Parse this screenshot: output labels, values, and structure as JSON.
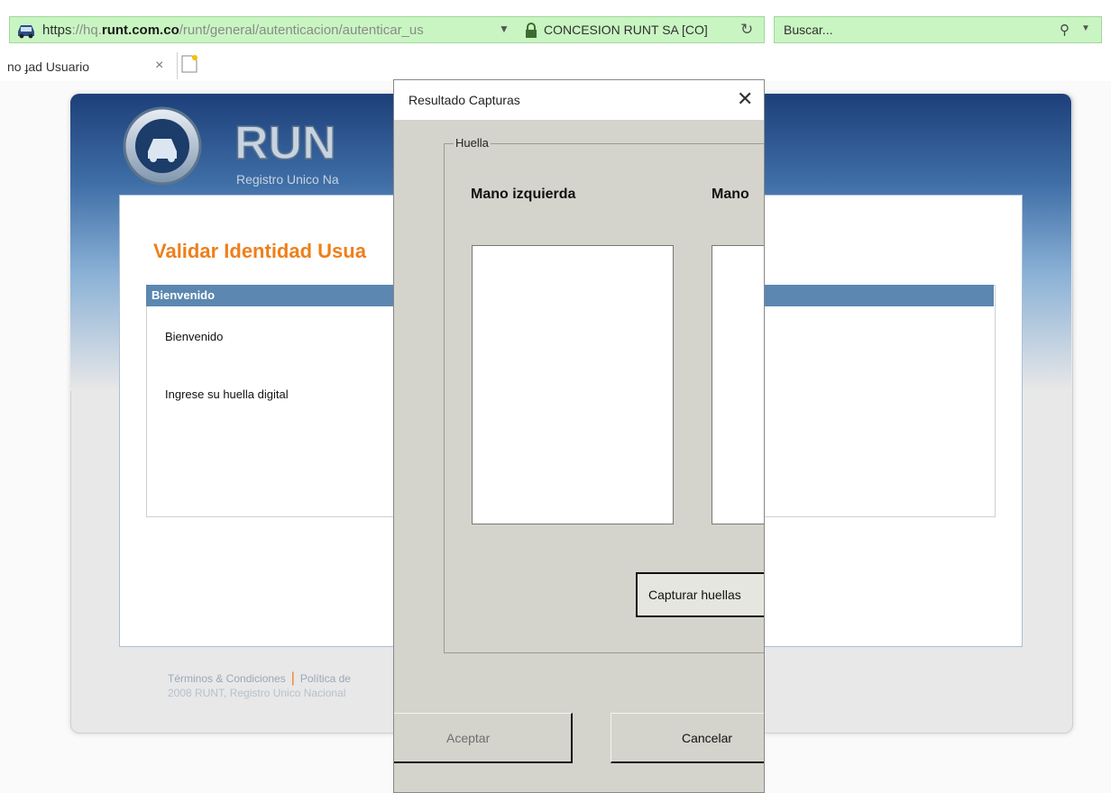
{
  "browser": {
    "url_scheme": "https",
    "url_sep": "://hq.",
    "url_host": "runt.com.co",
    "url_path": "/runt/general/autenticacion/autenticar_us",
    "site_identity": "CONCESION RUNT SA [CO]",
    "search_placeholder": "Buscar...",
    "tab_title": "no  ɟad Usuario",
    "tab_close": "×"
  },
  "page": {
    "logo_text": "RUN",
    "logo_subtitle": "Registro Unico Na",
    "title": "Validar Identidad Usua",
    "panel_header": "Bienvenido",
    "welcome": "Bienvenido",
    "instruction": "Ingrese su huella digital",
    "footer_terms": "Términos & Condiciones",
    "footer_separator": "|",
    "footer_policy": "Política de",
    "footer_copyright": "2008 RUNT, Registro Unico Nacional"
  },
  "dialog": {
    "title": "Resultado Capturas",
    "close": "✕",
    "group_label": "Huella",
    "left_hand": "Mano izquierda",
    "right_hand": "Mano",
    "capture_button": "Capturar huellas",
    "accept_button": "Aceptar",
    "cancel_button": "Cancelar"
  },
  "colors": {
    "address_bar": "#c9f5c2",
    "title_orange": "#ef7f1a",
    "panel_header_blue": "#5b87b0",
    "dialog_gray": "#d4d4cc"
  }
}
